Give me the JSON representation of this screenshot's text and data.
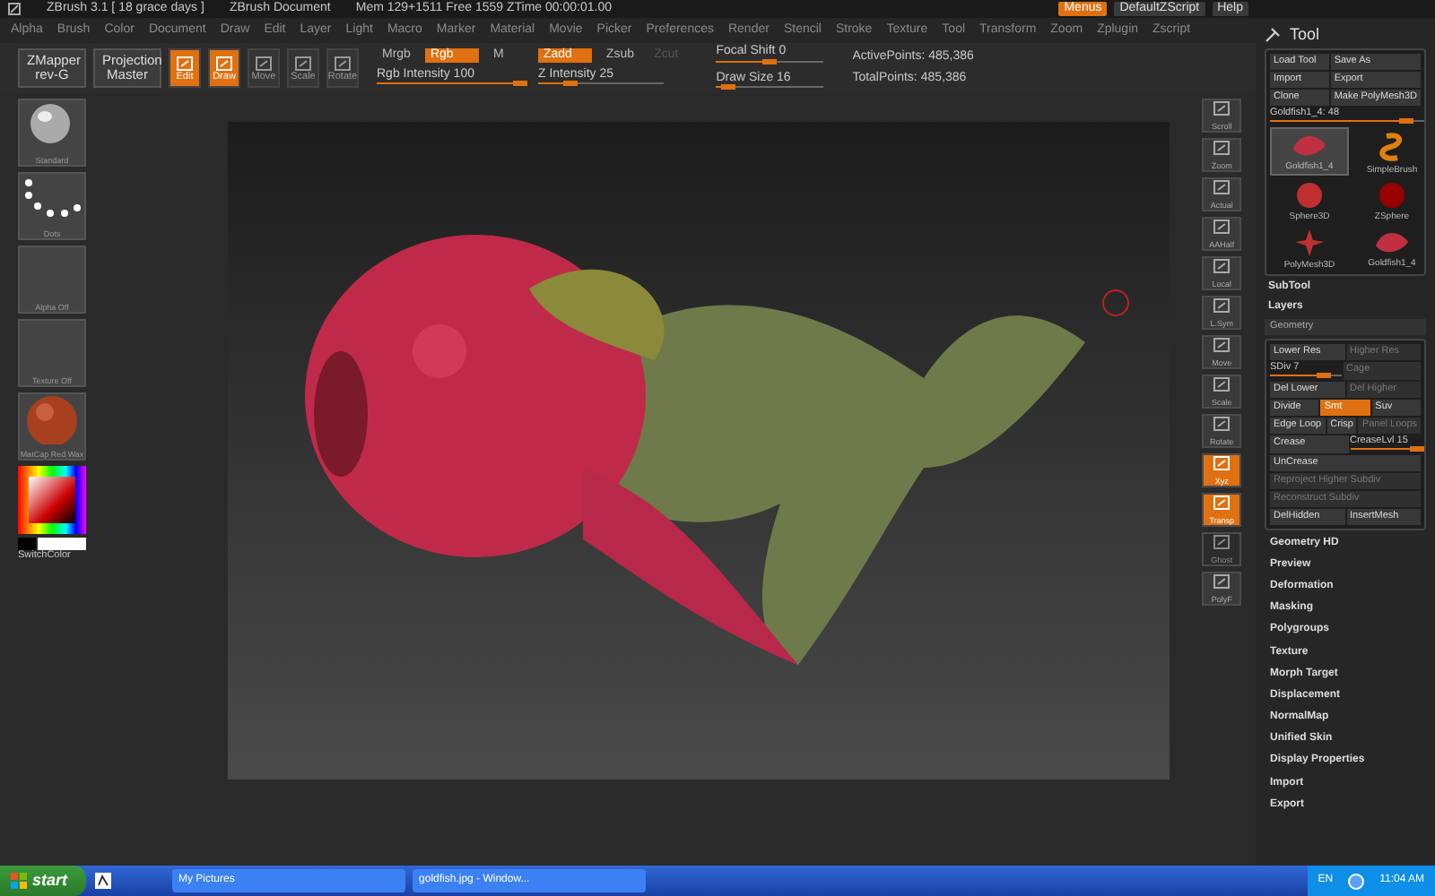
{
  "title_bar": {
    "app": "ZBrush  3.1 [ 18 grace days ]",
    "document": "ZBrush Document",
    "stats": "Mem 129+1511  Free 1559  ZTime 00:00:01.00",
    "buttons": [
      {
        "label": "Menus",
        "on": true
      },
      {
        "label": "DefaultZScript",
        "on": false
      },
      {
        "label": "Help",
        "on": false
      }
    ]
  },
  "menu": [
    "Alpha",
    "Brush",
    "Color",
    "Document",
    "Draw",
    "Edit",
    "Layer",
    "Light",
    "Macro",
    "Marker",
    "Material",
    "Movie",
    "Picker",
    "Preferences",
    "Render",
    "Stencil",
    "Stroke",
    "Texture",
    "Tool",
    "Transform",
    "Zoom",
    "Zplugin",
    "Zscript"
  ],
  "toolbar": {
    "panels": [
      {
        "label": "ZMapper",
        "sub": "rev-G"
      },
      {
        "label": "Projection",
        "sub": "Master"
      }
    ],
    "tools": [
      {
        "label": "Edit",
        "on": true
      },
      {
        "label": "Draw",
        "on": true
      },
      {
        "label": "Move",
        "on": false
      },
      {
        "label": "Scale",
        "on": false
      },
      {
        "label": "Rotate",
        "on": false
      }
    ],
    "color_modes": [
      {
        "label": "Mrgb",
        "on": false,
        "disabled": false
      },
      {
        "label": "Rgb",
        "on": true,
        "disabled": false
      },
      {
        "label": "M",
        "on": false,
        "disabled": false
      }
    ],
    "rgb_intensity": {
      "label": "Rgb Intensity 100",
      "level": 1
    },
    "z_modes": [
      {
        "label": "Zadd",
        "on": true,
        "disabled": false
      },
      {
        "label": "Zsub",
        "on": false,
        "disabled": false
      },
      {
        "label": "Zcut",
        "on": false,
        "disabled": true
      }
    ],
    "z_intensity": {
      "label": "Z Intensity 25",
      "level": 0.25
    },
    "focal_shift": {
      "label": "Focal Shift 0",
      "level": 0.5
    },
    "draw_size": {
      "label": "Draw Size 16",
      "level": 0.12
    },
    "active_points": "ActivePoints: 485,386",
    "total_points": "TotalPoints: 485,386"
  },
  "left_shelf": [
    {
      "kind": "brush",
      "label": "Standard"
    },
    {
      "kind": "stroke",
      "label": "Dots"
    },
    {
      "kind": "empty",
      "label": "Alpha Off"
    },
    {
      "kind": "empty",
      "label": "Texture Off"
    },
    {
      "kind": "material",
      "label": "MatCap Red Wax"
    }
  ],
  "color_picker": {
    "label": "SwitchColor"
  },
  "right_shelf": [
    {
      "label": "Scroll",
      "on": false,
      "disabled": false
    },
    {
      "label": "Zoom",
      "on": false,
      "disabled": false
    },
    {
      "label": "Actual",
      "on": false,
      "disabled": false
    },
    {
      "label": "AAHalf",
      "on": false,
      "disabled": false
    },
    {
      "label": "Local",
      "on": false,
      "disabled": false
    },
    {
      "label": "L.Sym",
      "on": false,
      "disabled": false
    },
    {
      "label": "Move",
      "on": false,
      "disabled": false
    },
    {
      "label": "Scale",
      "on": false,
      "disabled": false
    },
    {
      "label": "Rotate",
      "on": false,
      "disabled": false
    },
    {
      "label": "Xyz",
      "on": true,
      "disabled": false
    },
    {
      "label": "Transp",
      "on": true,
      "disabled": false
    },
    {
      "label": "Ghost",
      "on": false,
      "disabled": true
    },
    {
      "label": "PolyF",
      "on": false,
      "disabled": false
    }
  ],
  "tool_panel": {
    "title": "Tool",
    "buttons": [
      {
        "label": "Load Tool"
      },
      {
        "label": "Save As"
      },
      {
        "label": "Import"
      },
      {
        "label": "Export"
      },
      {
        "label": "Clone"
      },
      {
        "label": "Make PolyMesh3D"
      }
    ],
    "slider": {
      "label": "Goldfish1_4: 48",
      "level": 0.88
    },
    "tools": [
      {
        "kind": "mesh",
        "label": "Goldfish1_4",
        "selected": true
      },
      {
        "kind": "brush",
        "label": "SimpleBrush",
        "selected": false
      },
      {
        "kind": "sphere",
        "label": "Sphere3D",
        "selected": false
      },
      {
        "kind": "zsphere",
        "label": "ZSphere",
        "selected": false
      },
      {
        "kind": "polymesh",
        "label": "PolyMesh3D",
        "selected": false
      },
      {
        "kind": "mesh",
        "label": "Goldfish1_4",
        "selected": false
      }
    ],
    "sections": [
      "SubTool",
      "Layers"
    ],
    "geometry": {
      "title": "Geometry",
      "rows": [
        [
          {
            "kind": "button",
            "label": "Lower Res",
            "on": false,
            "disabled": false
          },
          {
            "kind": "button",
            "label": "Higher Res",
            "on": false,
            "disabled": true
          }
        ],
        [
          {
            "kind": "slider",
            "label": "SDiv 7",
            "level": 0.75
          },
          {
            "kind": "button",
            "label": "Cage",
            "on": false,
            "disabled": true
          }
        ],
        [
          {
            "kind": "button",
            "label": "Del Lower",
            "on": false,
            "disabled": false
          },
          {
            "kind": "button",
            "label": "Del Higher",
            "on": false,
            "disabled": true
          }
        ],
        [
          {
            "kind": "button",
            "label": "Divide",
            "on": false,
            "disabled": false
          },
          {
            "kind": "button",
            "label": "Smt",
            "on": true,
            "disabled": false
          },
          {
            "kind": "button",
            "label": "Suv",
            "on": false,
            "disabled": false
          }
        ],
        [
          {
            "kind": "button",
            "label": "Edge Loop",
            "on": false,
            "disabled": false
          },
          {
            "kind": "button",
            "label": "Crisp",
            "on": false,
            "disabled": false
          },
          {
            "kind": "button",
            "label": "Panel Loops",
            "on": false,
            "disabled": true
          }
        ],
        [
          {
            "kind": "button",
            "label": "Crease",
            "on": false,
            "disabled": false
          },
          {
            "kind": "slider",
            "label": "CreaseLvl 15",
            "level": 0.95
          }
        ],
        [
          {
            "kind": "button",
            "label": "UnCrease",
            "on": false,
            "disabled": false
          }
        ],
        [
          {
            "kind": "button",
            "label": "Reproject Higher Subdiv",
            "on": false,
            "disabled": true
          }
        ],
        [
          {
            "kind": "button",
            "label": "Reconstruct Subdiv",
            "on": false,
            "disabled": true
          }
        ],
        [
          {
            "kind": "button",
            "label": "DelHidden",
            "on": false,
            "disabled": false
          },
          {
            "kind": "button",
            "label": "InsertMesh",
            "on": false,
            "disabled": false
          }
        ]
      ]
    },
    "menu_items": [
      "Geometry HD",
      "Preview",
      "Deformation",
      "Masking",
      "Polygroups",
      "Texture",
      "Morph Target",
      "Displacement",
      "NormalMap",
      "Unified Skin",
      "Display Properties",
      "Import",
      "Export"
    ]
  },
  "taskbar": {
    "start": "start",
    "windows": [
      {
        "label": "My Pictures",
        "selected": false
      },
      {
        "label": "goldfish.jpg - Window...",
        "selected": false
      }
    ],
    "language": "EN",
    "clock": "11:04 AM"
  }
}
